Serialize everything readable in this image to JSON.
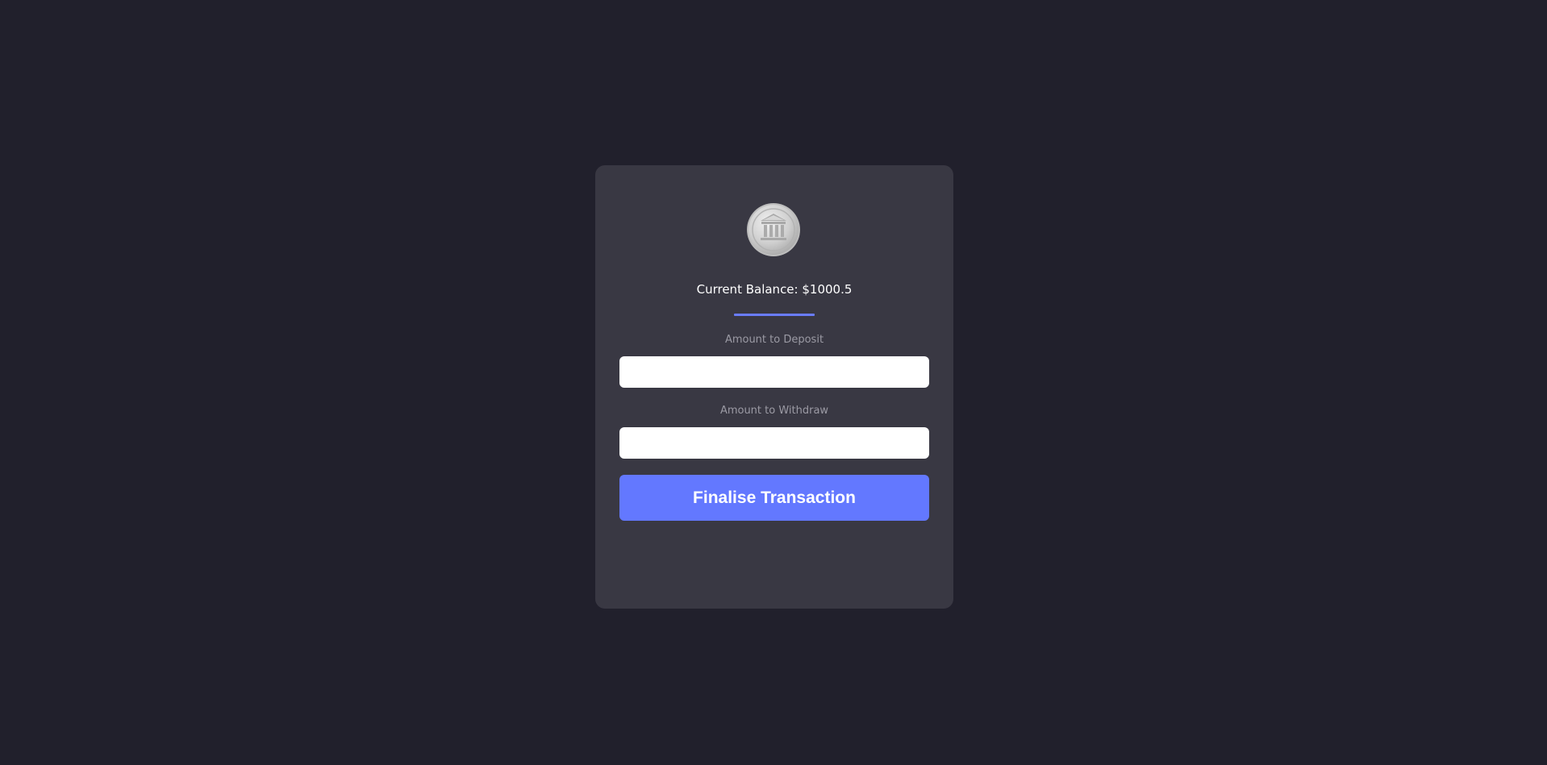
{
  "balance": {
    "label": "Current Balance: $1000.5"
  },
  "deposit": {
    "label": "Amount to Deposit",
    "value": "",
    "placeholder": ""
  },
  "withdraw": {
    "label": "Amount to Withdraw",
    "value": "",
    "placeholder": ""
  },
  "actions": {
    "submit_label": "Finalise Transaction"
  },
  "icons": {
    "logo": "bank-icon"
  },
  "colors": {
    "background": "#21202c",
    "card": "#393843",
    "accent": "#6378ff",
    "label": "#9b9aa4"
  }
}
